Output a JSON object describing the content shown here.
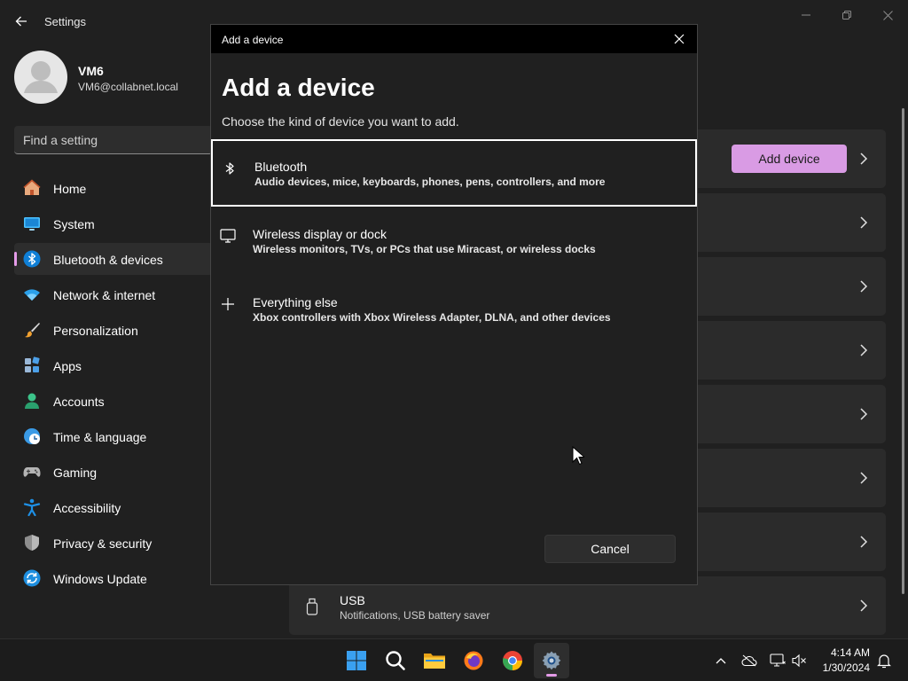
{
  "window": {
    "app_title": "Settings",
    "back_icon": "back-arrow-icon",
    "minimize_icon": "minimize-icon",
    "maximize_icon": "restore-icon",
    "close_icon": "close-icon"
  },
  "profile": {
    "name": "VM6",
    "email": "VM6@collabnet.local"
  },
  "search": {
    "placeholder": "Find a setting"
  },
  "sidebar": {
    "items": [
      {
        "label": "Home",
        "icon": "home-icon",
        "selected": false
      },
      {
        "label": "System",
        "icon": "monitor-icon",
        "selected": false
      },
      {
        "label": "Bluetooth & devices",
        "icon": "bluetooth-icon",
        "selected": true
      },
      {
        "label": "Network & internet",
        "icon": "wifi-icon",
        "selected": false
      },
      {
        "label": "Personalization",
        "icon": "brush-icon",
        "selected": false
      },
      {
        "label": "Apps",
        "icon": "apps-icon",
        "selected": false
      },
      {
        "label": "Accounts",
        "icon": "person-icon",
        "selected": false
      },
      {
        "label": "Time & language",
        "icon": "clock-globe-icon",
        "selected": false
      },
      {
        "label": "Gaming",
        "icon": "gamepad-icon",
        "selected": false
      },
      {
        "label": "Accessibility",
        "icon": "accessibility-icon",
        "selected": false
      },
      {
        "label": "Privacy & security",
        "icon": "shield-icon",
        "selected": false
      },
      {
        "label": "Windows Update",
        "icon": "sync-icon",
        "selected": false
      }
    ],
    "accent_color": "#e49be8"
  },
  "main": {
    "add_device_label": "Add device",
    "usb": {
      "title": "USB",
      "description": "Notifications, USB battery saver"
    }
  },
  "dialog": {
    "titlebar": "Add a device",
    "heading": "Add a device",
    "subtitle": "Choose the kind of device you want to add.",
    "options": [
      {
        "title": "Bluetooth",
        "description": "Audio devices, mice, keyboards, phones, pens, controllers, and more",
        "icon": "bluetooth-icon"
      },
      {
        "title": "Wireless display or dock",
        "description": "Wireless monitors, TVs, or PCs that use Miracast, or wireless docks",
        "icon": "monitor-icon"
      },
      {
        "title": "Everything else",
        "description": "Xbox controllers with Xbox Wireless Adapter, DLNA, and other devices",
        "icon": "plus-icon"
      }
    ],
    "cancel_label": "Cancel"
  },
  "taskbar": {
    "apps": [
      {
        "name": "start",
        "icon": "windows-logo-icon"
      },
      {
        "name": "search",
        "icon": "search-icon"
      },
      {
        "name": "file-explorer",
        "icon": "folder-icon"
      },
      {
        "name": "firefox",
        "icon": "firefox-icon"
      },
      {
        "name": "chrome",
        "icon": "chrome-icon"
      },
      {
        "name": "settings",
        "icon": "gear-icon",
        "active": true
      }
    ],
    "tray": [
      "chevron-up-icon",
      "cloud-offline-icon",
      "network-icon",
      "volume-muted-icon"
    ],
    "clock": {
      "time": "4:14 AM",
      "date": "1/30/2024"
    },
    "notification_icon": "bell-icon"
  }
}
